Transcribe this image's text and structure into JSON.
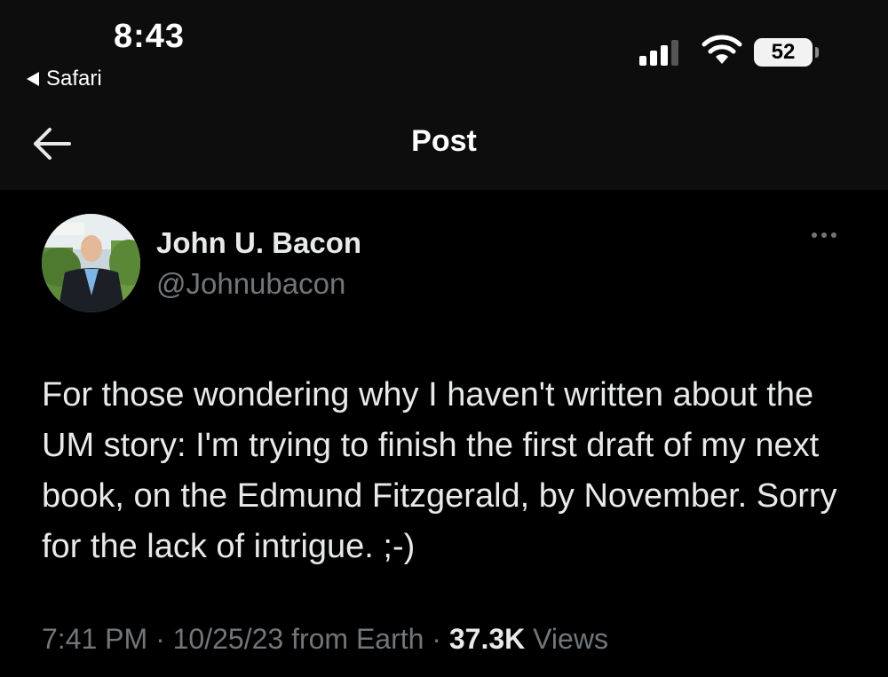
{
  "status_bar": {
    "time": "8:43",
    "back_app": "Safari",
    "battery": "52",
    "icons": [
      "cellular-signal-icon",
      "wifi-icon",
      "battery-icon"
    ]
  },
  "header": {
    "title": "Post",
    "back_icon": "arrow-left-icon"
  },
  "post": {
    "author_name": "John U. Bacon",
    "handle": "@Johnubacon",
    "more_icon": "ellipsis-icon",
    "text": "For those wondering why I haven't written about the UM story: I'm trying to finish the first draft of my next book, on the Edmund Fitzgerald, by November. Sorry for the lack of intrigue. ;-)",
    "time": "7:41 PM",
    "date": "10/25/23",
    "source": "from Earth",
    "views_count": "37.3K",
    "views_label": "Views",
    "separator": "·"
  },
  "colors": {
    "background": "#000000",
    "header_background": "#0d0d0d",
    "text_primary": "#e7e9ea",
    "text_secondary": "#71767b"
  }
}
